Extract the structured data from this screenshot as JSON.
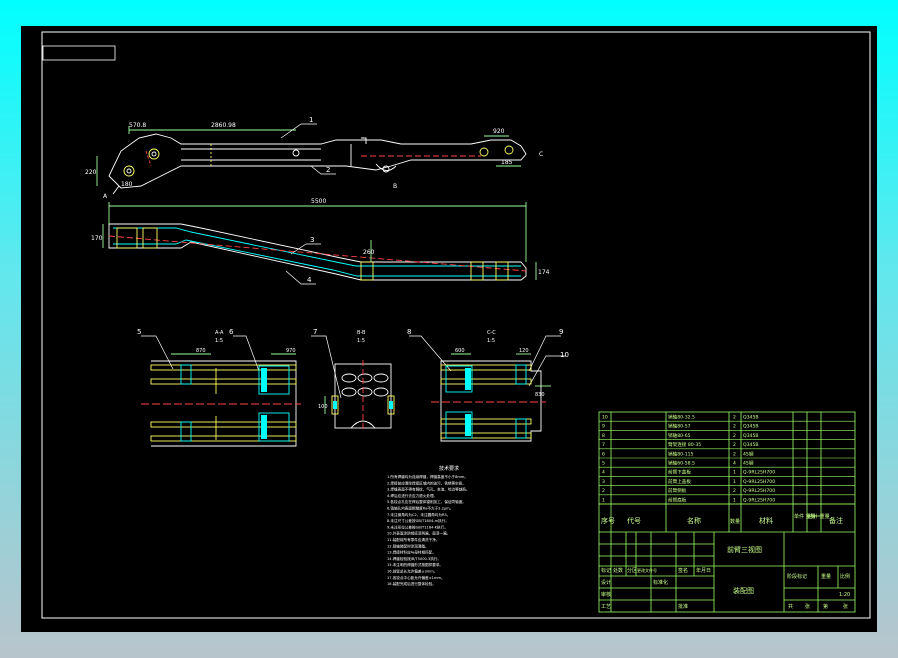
{
  "title_block": {
    "drawing_name": "前臂三视图",
    "assembly_label": "装配图",
    "scale": "1:20",
    "col_seq": "序号",
    "col_code": "代号",
    "col_name": "名称",
    "col_qty": "数量",
    "col_material": "材料",
    "col_mass": "单件 重量",
    "col_total": "总计 重量",
    "col_note": "备注",
    "lbl_mark": "标记",
    "lbl_count": "处数",
    "lbl_zone": "分区",
    "lbl_docno": "更改文件号",
    "lbl_sign": "签名",
    "lbl_date": "年月日",
    "lbl_design": "设计",
    "lbl_std": "标准化",
    "lbl_check": "审核",
    "lbl_process": "工艺",
    "lbl_approve": "批准",
    "lbl_stage": "阶段标记",
    "lbl_weight": "重量",
    "lbl_scale": "比例",
    "lbl_total_sheets": "共",
    "lbl_sheet": "张",
    "lbl_no": "第",
    "lbl_sheet2": "张"
  },
  "bom": [
    {
      "no": "10",
      "code": "",
      "name": "销轴80-32.5",
      "qty": "2",
      "material": "Q345B"
    },
    {
      "no": "9",
      "code": "",
      "name": "销轴80-57",
      "qty": "2",
      "material": "Q345B"
    },
    {
      "no": "8",
      "code": "",
      "name": "销轴80-65",
      "qty": "2",
      "material": "Q345B"
    },
    {
      "no": "7",
      "code": "",
      "name": "臂架连接 80-35",
      "qty": "2",
      "material": "Q345B"
    },
    {
      "no": "6",
      "code": "",
      "name": "销轴80-115",
      "qty": "2",
      "material": "45钢"
    },
    {
      "no": "5",
      "code": "",
      "name": "销轴60-58.5",
      "qty": "4",
      "material": "45钢"
    },
    {
      "no": "4",
      "code": "",
      "name": "前臂下盖板",
      "qty": "1",
      "material": "Q-9RL25H700"
    },
    {
      "no": "3",
      "code": "",
      "name": "前臂上盖板",
      "qty": "1",
      "material": "Q-9RL25H700"
    },
    {
      "no": "2",
      "code": "",
      "name": "前臂侧板",
      "qty": "2",
      "material": "Q-9RL25H700"
    },
    {
      "no": "1",
      "code": "",
      "name": "前臂底板",
      "qty": "1",
      "material": "Q-9RL25H700"
    }
  ],
  "notes": {
    "title": "技术要求",
    "lines": [
      "1.所有焊缝均为连续焊缝，焊缝高度不小于8mm。",
      "2.焊接前应清除焊接区域内的油污、铁锈等杂质。",
      "3.焊缝表面不得有裂纹、气孔、夹渣、咬边等缺陷。",
      "4.焊后应进行去应力退火处理。",
      "5.各铰点孔应在焊后整体镗削加工，保证同轴度。",
      "6.销轴孔内表面粗糙度Ra不大于3.2μm。",
      "7.未注倒角均为C2，未注圆角均为R5。",
      "8.未注尺寸公差按GB/T1804-m执行。",
      "9.未注形位公差按GB/T1184-K执行。",
      "10.外表面涂防锈底漆两遍，面漆一遍。",
      "11.装配前所有零件应清洗干净。",
      "12.销轴装配时涂润滑脂。",
      "13.焊接材料应与母材相匹配。",
      "14.焊缝检验按JB/T5000.3执行。",
      "15.未注明的焊缝形式按图样要求。",
      "16.前臂总长允许偏差±3mm。",
      "17.各铰点中心距允许偏差±1mm。",
      "18.装配完成后进行整体检验。"
    ]
  },
  "views": {
    "front": {
      "dim_a": "570.8",
      "dim_b": "2860.98",
      "dim_c": "920",
      "dim_d": "185",
      "dim_left": "220",
      "dim_bot": "180",
      "lbl_a": "A",
      "lbl_b": "B",
      "lbl_c": "C"
    },
    "top": {
      "dim_len": "5500",
      "dim_left": "170",
      "dim_mid": "260",
      "dim_right": "174"
    },
    "section_aa": {
      "title": "A-A",
      "scale": "1:5",
      "dim1": "870",
      "dim2": "970"
    },
    "section_bb": {
      "title": "B-B",
      "scale": "1:5",
      "dim1": "100"
    },
    "section_cc": {
      "title": "C-C",
      "scale": "1:5",
      "dim1": "600",
      "dim2": "120",
      "dim3": "830"
    }
  },
  "balloons": [
    "1",
    "2",
    "3",
    "4",
    "5",
    "6",
    "7",
    "8",
    "9",
    "10"
  ]
}
